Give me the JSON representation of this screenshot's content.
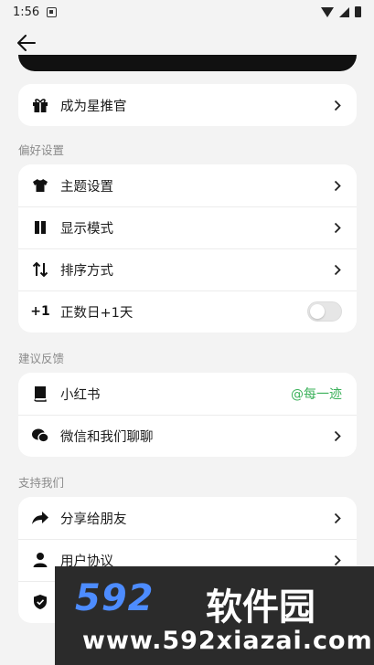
{
  "status_bar": {
    "time": "1:56"
  },
  "items": {
    "recommend": "成为星推官",
    "theme": "主题设置",
    "display": "显示模式",
    "sort": "排序方式",
    "positive_day": "正数日+1天",
    "xiaohongshu": "小红书",
    "xiaohongshu_handle": "@每一迹",
    "wechat": "微信和我们聊聊",
    "share": "分享给朋友",
    "agreement": "用户协议"
  },
  "sections": {
    "preferences": "偏好设置",
    "feedback": "建议反馈",
    "support": "支持我们"
  },
  "toggle": {
    "positive_day_on": false
  },
  "watermark": {
    "logo_num": "592",
    "logo_cn": "软件园",
    "url": "www.592xiazai.com"
  },
  "colors": {
    "accent_green": "#3bb15a",
    "card_bg": "#ffffff",
    "page_bg": "#f3f3f3"
  },
  "icons": [
    "back-arrow-icon",
    "gift-icon",
    "shirt-icon",
    "columns-icon",
    "sort-icon",
    "plus-one-icon",
    "book-icon",
    "chat-icon",
    "share-icon",
    "user-icon",
    "shield-icon",
    "chevron-right-icon"
  ]
}
